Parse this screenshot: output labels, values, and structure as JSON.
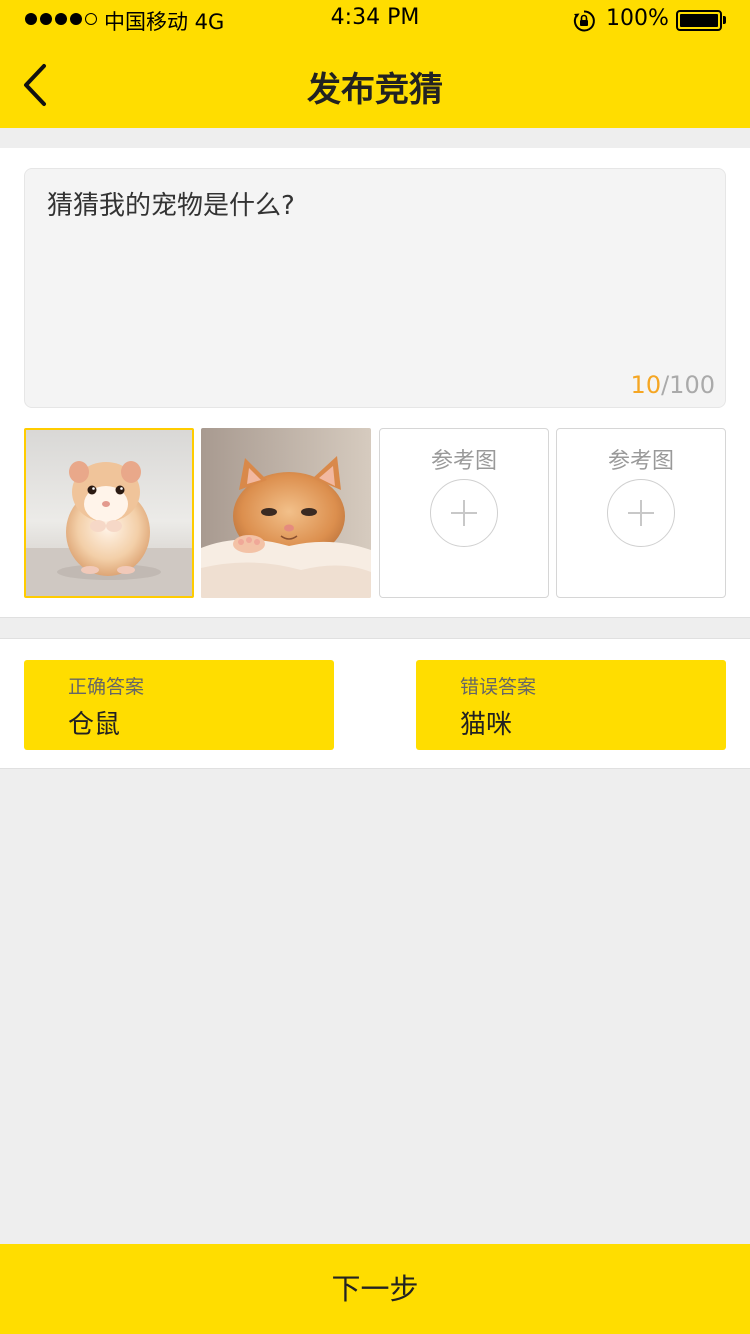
{
  "status_bar": {
    "carrier": "中国移动 4G",
    "time": "4:34 PM",
    "battery": "100%",
    "signal_strength": 4,
    "signal_max": 5
  },
  "nav": {
    "title": "发布竞猜",
    "back_icon": "chevron-left-icon"
  },
  "question": {
    "text": "猜猜我的宠物是什么?",
    "count_current": "10",
    "count_max": "/100"
  },
  "images": {
    "slot1": "hamster-photo",
    "slot2": "kitten-photo",
    "ref_label_1": "参考图",
    "ref_label_2": "参考图",
    "add_icon": "plus-icon"
  },
  "answers": {
    "correct": {
      "label": "正确答案",
      "value": "仓鼠"
    },
    "wrong": {
      "label": "错误答案",
      "value": "猫咪"
    }
  },
  "footer": {
    "next_label": "下一步"
  },
  "colors": {
    "accent": "#FFDD00",
    "counter_highlight": "#F5A623",
    "background": "#EEEEEE"
  }
}
